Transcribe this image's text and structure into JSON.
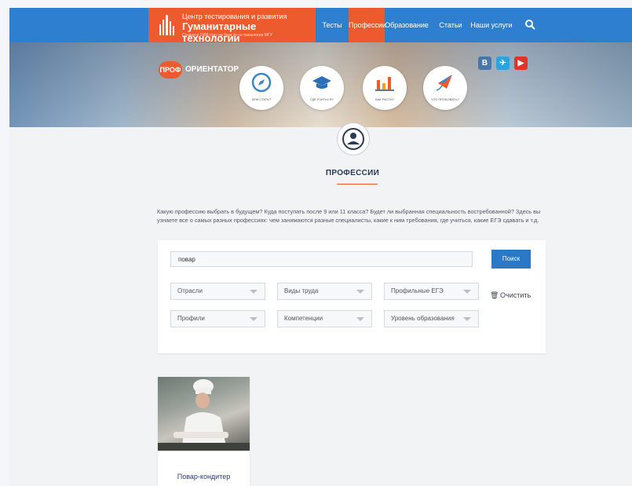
{
  "header": {
    "logo_line1": "Центр тестирования и развития",
    "logo_line2": "Гуманитарные технологии",
    "logo_line3": "Создан в 1998 году на базе ф-та психологии МГУ",
    "nav": [
      "Тесты",
      "Профессии",
      "Образование",
      "Статьи",
      "Наши услуги"
    ],
    "active_nav": "Профессии"
  },
  "hero": {
    "badge": "ПРОФ",
    "word": "ОРИЕНТАТОР",
    "circles": [
      "КЕМ СТАТЬ?",
      "ГДЕ УЧИТЬСЯ?",
      "КАК РАСТИ?",
      "ЧТО ПРОБОВАТЬ?"
    ],
    "social": [
      "В",
      "✈",
      "▶"
    ]
  },
  "section": {
    "title": "ПРОФЕССИИ",
    "intro": "Какую профессию выбрать в будущем? Куда поступать после 9 или 11 класса? Будет ли выбранная специальность востребованной? Здесь вы узнаете все о самых разных профессиях: чем занимаются разные специалисты, какие к ним требования, где учиться, какие ЕГЭ сдавать и т.д."
  },
  "search": {
    "value": "повар",
    "button": "Поиск",
    "filters_row1": [
      "Отрасли",
      "Виды труда",
      "Профильные ЕГЭ"
    ],
    "filters_row2": [
      "Профили",
      "Компетенции",
      "Уровень образования"
    ],
    "clear": "Очистить"
  },
  "results": [
    {
      "title": "Повар-кондитер"
    }
  ],
  "colors": {
    "brand_orange": "#ed5a2e",
    "nav_blue": "#2f7fd0",
    "button_blue": "#2b78c6"
  }
}
